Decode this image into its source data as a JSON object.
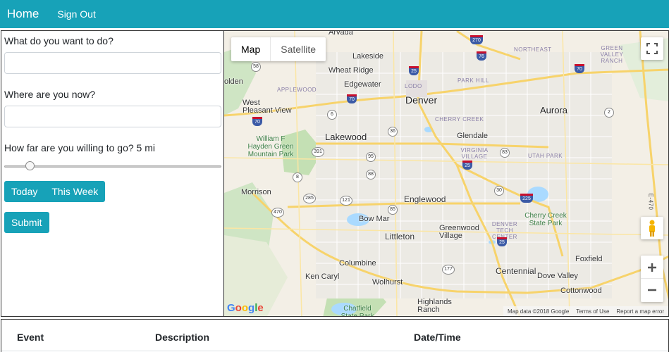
{
  "nav": {
    "home": "Home",
    "sign_out": "Sign Out"
  },
  "form": {
    "what_label": "What do you want to do?",
    "what_value": "",
    "where_label": "Where are you now?",
    "where_value": "",
    "distance_label": "How far are you willing to go? 5 mi",
    "distance_fraction": 0.1,
    "today_button": "Today",
    "week_button": "This Week",
    "submit_button": "Submit"
  },
  "map": {
    "map_tab": "Map",
    "satellite_tab": "Satellite",
    "cities": {
      "arvada": "Arvada",
      "lakeside": "Lakeside",
      "wheat_ridge": "Wheat Ridge",
      "edgewater": "Edgewater",
      "golden": "olden",
      "west_pleasant_view": "West Pleasant View",
      "denver": "Denver",
      "aurora": "Aurora",
      "lakewood": "Lakewood",
      "glendale": "Glendale",
      "morrison": "Morrison",
      "englewood": "Englewood",
      "bow_mar": "Bow Mar",
      "littleton": "Littleton",
      "greenwood_village": "Greenwood Village",
      "columbine": "Columbine",
      "ken_caryl": "Ken Caryl",
      "wolhurst": "Wolhurst",
      "centennial": "Centennial",
      "dove_valley": "Dove Valley",
      "foxfield": "Foxfield",
      "cottonwood": "Cottonwood",
      "highlands_ranch": "Highlands Ranch"
    },
    "districts": {
      "northeast": "NORTHEAST",
      "green_valley_ranch": "GREEN VALLEY RANCH",
      "applewood": "APPLEWOOD",
      "lodo": "LODO",
      "park_hill": "PARK HILL",
      "cherry_creek": "CHERRY CREEK",
      "virginia_village": "VIRGINIA VILLAGE",
      "utah_park": "UTAH PARK",
      "denver_tech_center": "DENVER TECH CENTER"
    },
    "parks": {
      "hayden": "William F Hayden Green Mountain Park",
      "cherry_creek_sp": "Cherry Creek State Park",
      "chatfield": "Chatfield State Park"
    },
    "highways": {
      "i70_w": "70",
      "i70_mid": "70",
      "i70_e": "70",
      "i25_n": "25",
      "i25_s": "25",
      "i25_far": "25",
      "i225": "225",
      "i270": "270",
      "i76": "76",
      "e470": "E-470"
    },
    "routes": [
      "58",
      "95",
      "391",
      "6",
      "8",
      "121",
      "285",
      "88",
      "30",
      "470",
      "83",
      "2",
      "177",
      "85",
      "36"
    ],
    "logo": "Google",
    "attribution": {
      "data": "Map data ©2018 Google",
      "terms": "Terms of Use",
      "report": "Report a map error"
    }
  },
  "events_table": {
    "headers": [
      "Event",
      "Description",
      "Date/Time"
    ]
  }
}
